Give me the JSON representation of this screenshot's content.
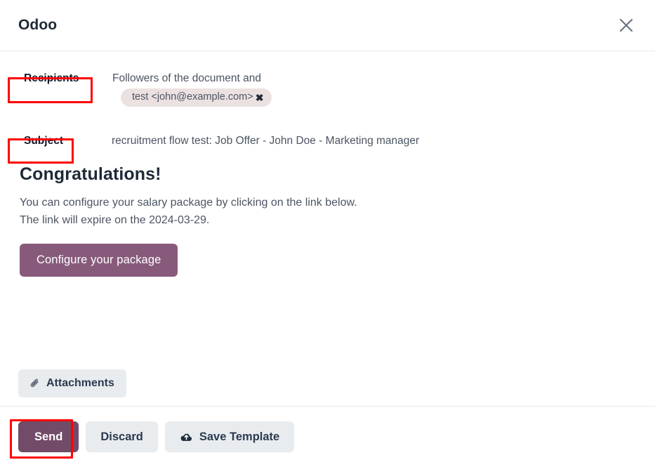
{
  "dialog": {
    "title": "Odoo",
    "close_icon": "close-x-icon"
  },
  "fields": {
    "recipients": {
      "label": "Recipients",
      "followers_text": "Followers of the document and",
      "tag": {
        "text": "test <john@example.com>",
        "remove_icon": "✖"
      }
    },
    "subject": {
      "label": "Subject",
      "value": "recruitment flow test: Job Offer - John Doe - Marketing manager"
    }
  },
  "email_body": {
    "heading": "Congratulations!",
    "line1": "You can configure your salary package by clicking on the link below.",
    "line2": "The link will expire on the 2024-03-29.",
    "cta_label": "Configure your package",
    "cta_color": "#875A7B"
  },
  "attachments": {
    "label": "Attachments",
    "icon": "paperclip-icon"
  },
  "footer": {
    "send_label": "Send",
    "send_color": "#714B67",
    "discard_label": "Discard",
    "save_template_label": "Save Template",
    "save_template_icon": "cloud-upload-icon"
  },
  "annotations": {
    "color": "#FF0000",
    "boxes": [
      "recipients-label",
      "subject-label",
      "send-button"
    ]
  }
}
